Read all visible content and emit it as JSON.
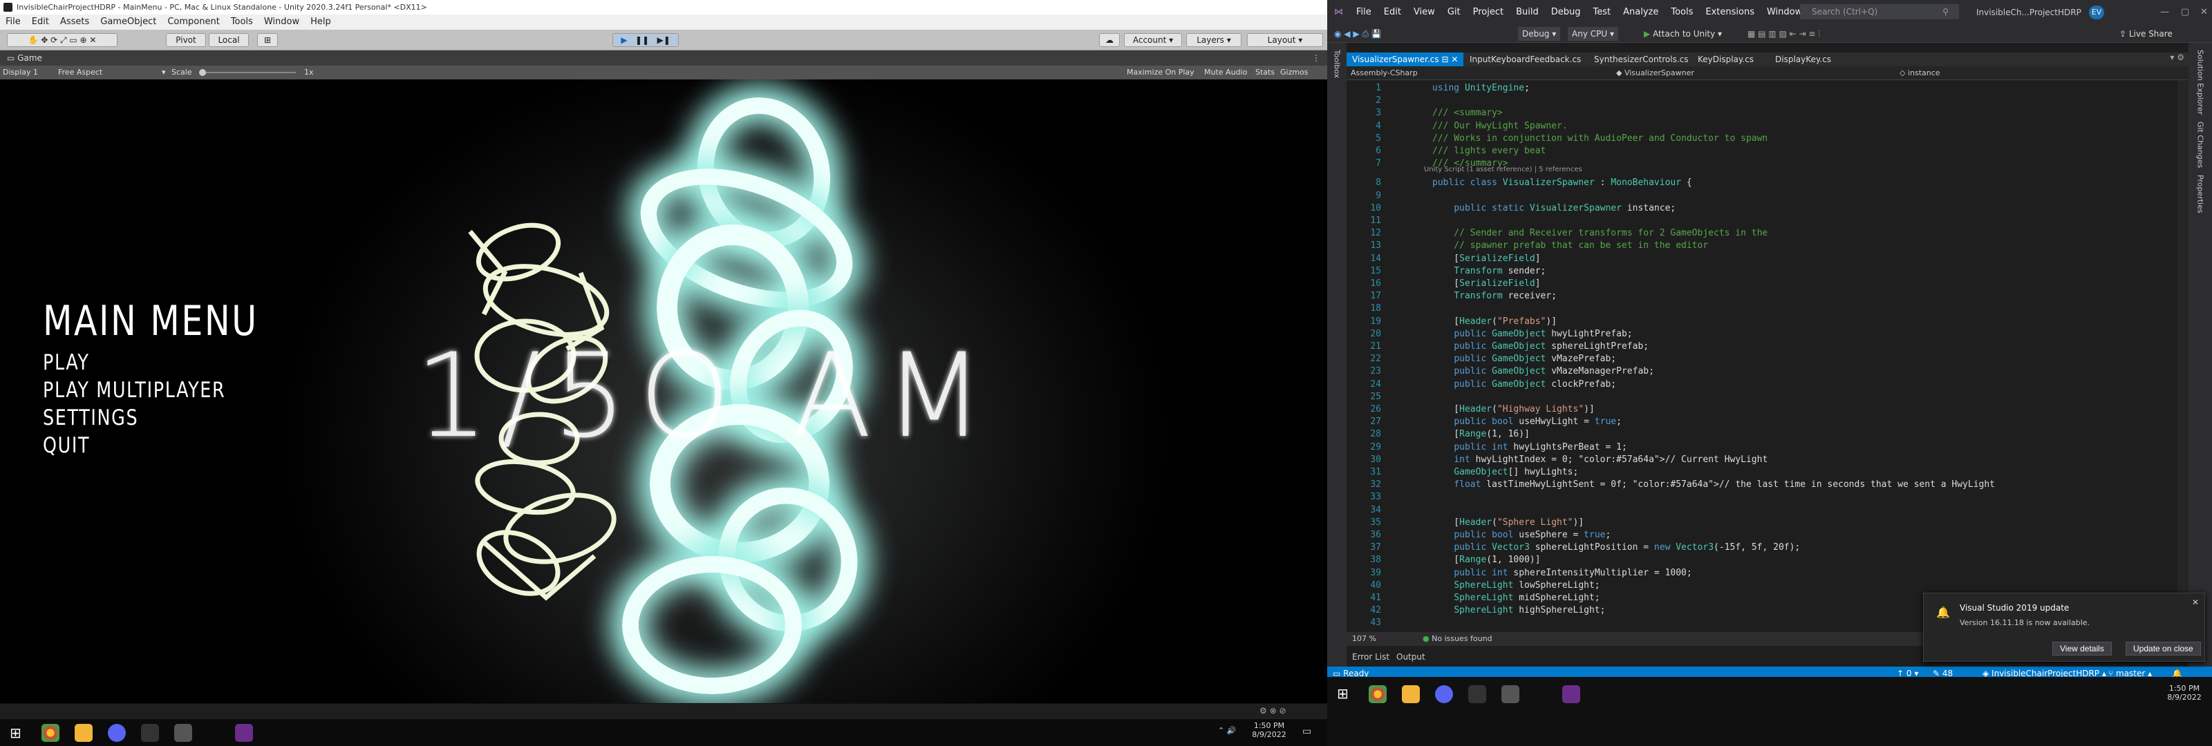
{
  "unity": {
    "title": "InvisibleChairProjectHDRP - MainMenu - PC, Mac & Linux Standalone - Unity 2020.3.24f1 Personal* <DX11>",
    "menu": [
      "File",
      "Edit",
      "Assets",
      "GameObject",
      "Component",
      "Tools",
      "Window",
      "Help"
    ],
    "toolbar": {
      "pivot": "Pivot",
      "local": "Local",
      "account": "Account",
      "layers": "Layers",
      "layout": "Layout"
    },
    "game_tab": "Game",
    "game_bar": {
      "display": "Display 1",
      "aspect": "Free Aspect",
      "scale_label": "Scale",
      "scale_value": "1x",
      "maximize": "Maximize On Play",
      "mute": "Mute Audio",
      "stats": "Stats",
      "gizmos": "Gizmos"
    },
    "main_menu": {
      "title": "MAIN MENU",
      "items": [
        "PLAY",
        "PLAY MULTIPLAYER",
        "SETTINGS",
        "QUIT"
      ]
    },
    "clock": "1/5O AM",
    "taskbar": {
      "time": "1:50 PM",
      "date": "8/9/2022"
    }
  },
  "vs": {
    "menu": [
      "File",
      "Edit",
      "View",
      "Git",
      "Project",
      "Build",
      "Debug",
      "Test",
      "Analyze",
      "Tools",
      "Extensions",
      "Window",
      "Help"
    ],
    "search_placeholder": "Search (Ctrl+Q)",
    "window_title": "InvisibleCh...ProjectHDRP",
    "user_initials": "EV",
    "toolbar": {
      "config": "Debug",
      "platform": "Any CPU",
      "attach": "Attach to Unity",
      "live_share": "Live Share"
    },
    "tabs": [
      "VisualizerSpawner.cs",
      "InputKeyboardFeedback.cs",
      "SynthesizerControls.cs",
      "KeyDisplay.cs",
      "DisplayKey.cs"
    ],
    "nav": {
      "project": "Assembly-CSharp",
      "class": "VisualizerSpawner",
      "member": "instance"
    },
    "left_toolbar": "Toolbox",
    "right_panels": [
      "Solution Explorer",
      "Git Changes",
      "Properties"
    ],
    "codelens": "Unity Script (1 asset reference) | 5 references",
    "code": [
      "using UnityEngine;",
      "",
      "/// <summary>",
      "/// Our HwyLight Spawner.",
      "/// Works in conjunction with AudioPeer and Conductor to spawn",
      "/// lights every beat",
      "/// </summary>",
      "public class VisualizerSpawner : MonoBehaviour {",
      "",
      "    public static VisualizerSpawner instance;",
      "",
      "    // Sender and Receiver transforms for 2 GameObjects in the",
      "    // spawner prefab that can be set in the editor",
      "    [SerializeField]",
      "    Transform sender;",
      "    [SerializeField]",
      "    Transform receiver;",
      "",
      "    [Header(\"Prefabs\")]",
      "    public GameObject hwyLightPrefab;",
      "    public GameObject sphereLightPrefab;",
      "    public GameObject vMazePrefab;",
      "    public GameObject vMazeManagerPrefab;",
      "    public GameObject clockPrefab;",
      "",
      "    [Header(\"Highway Lights\")]",
      "    public bool useHwyLight = true;",
      "    [Range(1, 16)]",
      "    public int hwyLightsPerBeat = 1;",
      "    int hwyLightIndex = 0; // Current HwyLight",
      "    GameObject[] hwyLights;",
      "    float lastTimeHwyLightSent = 0f; // the last time in seconds that we sent a HwyLight",
      "",
      "",
      "    [Header(\"Sphere Light\")]",
      "    public bool useSphere = true;",
      "    public Vector3 sphereLightPosition = new Vector3(-15f, 5f, 20f);",
      "    [Range(1, 1000)]",
      "    public int sphereIntensityMultiplier = 1000;",
      "    SphereLight lowSphereLight;",
      "    SphereLight midSphereLight;",
      "    SphereLight highSphereLight;",
      ""
    ],
    "zoom": "107 %",
    "issues": "No issues found",
    "bottom_tabs": [
      "Error List",
      "Output"
    ],
    "status": {
      "ready": "Ready",
      "up": "0",
      "pencil": "48",
      "project": "InvisibleChairProjectHDRP",
      "branch": "master"
    },
    "toast": {
      "title": "Visual Studio 2019 update",
      "body": "Version 16.11.18 is now available.",
      "details": "View details",
      "close": "Update on close"
    },
    "taskbar": {
      "time": "1:50 PM",
      "date": "8/9/2022"
    }
  }
}
